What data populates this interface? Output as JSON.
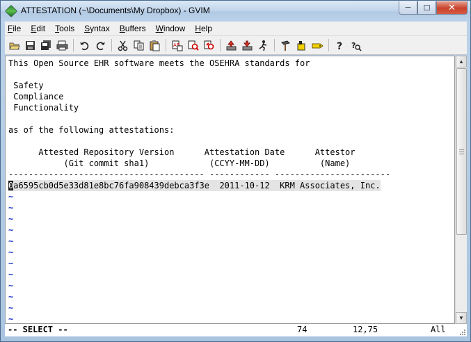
{
  "window": {
    "title": "ATTESTATION (~\\Documents\\My Dropbox) - GVIM"
  },
  "caption_buttons": {
    "minimize": "─",
    "maximize": "☐",
    "close": "✕"
  },
  "menu": [
    {
      "accel": "F",
      "rest": "ile"
    },
    {
      "accel": "E",
      "rest": "dit"
    },
    {
      "accel": "T",
      "rest": "ools"
    },
    {
      "accel": "S",
      "rest": "yntax"
    },
    {
      "accel": "B",
      "rest": "uffers"
    },
    {
      "accel": "W",
      "rest": "indow"
    },
    {
      "accel": "H",
      "rest": "elp"
    }
  ],
  "toolbar": [
    "open-icon",
    "save-icon",
    "save-all-icon",
    "print-icon",
    "undo-icon",
    "redo-icon",
    "cut-icon",
    "copy-icon",
    "paste-icon",
    "replace-icon",
    "find-next-icon",
    "find-prev-icon",
    "load-session-icon",
    "save-session-icon",
    "run-script-icon",
    "make-icon",
    "build-tags-icon",
    "tag-jump-icon",
    "help-icon",
    "find-help-icon"
  ],
  "editor": {
    "lines": [
      "This Open Source EHR software meets the OSEHRA standards for",
      "",
      " Safety",
      " Compliance",
      " Functionality",
      "",
      "as of the following attestations:",
      "",
      "      Attested Repository Version      Attestation Date      Attestor",
      "           (Git commit sha1)            (CCYY-MM-DD)          (Name)",
      "--------------------------------------- ------------ -----------------------"
    ],
    "selected_line": {
      "cursor_char": "0",
      "text": "a6595cb0d5e33d81e8bc76fa908439debca3f3e  2011-10-12  KRM Associates, Inc."
    },
    "tilde_count": 12,
    "tilde_char": "~"
  },
  "status": {
    "mode": "-- SELECT --",
    "count": "74",
    "position": "12,75",
    "scroll": "All"
  },
  "colors": {
    "tilde": "#1a32c8",
    "selection": "#e4e4e4"
  }
}
